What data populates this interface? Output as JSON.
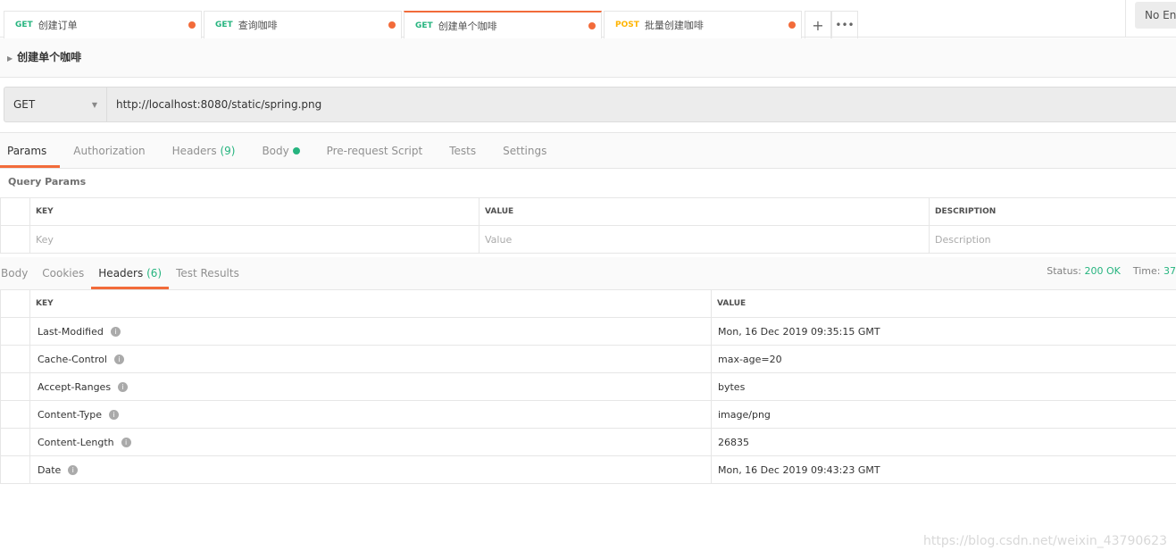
{
  "tabs": [
    {
      "method": "GET",
      "name": "创建订单",
      "method_color": "#26b47f",
      "active": false
    },
    {
      "method": "GET",
      "name": "查询咖啡",
      "method_color": "#26b47f",
      "active": false
    },
    {
      "method": "GET",
      "name": "创建单个咖啡",
      "method_color": "#26b47f",
      "active": true
    },
    {
      "method": "POST",
      "name": "批量创建咖啡",
      "method_color": "#ffb400",
      "active": false
    }
  ],
  "environment": "No En",
  "request_name": "创建单个咖啡",
  "method": "GET",
  "url": "http://localhost:8080/static/spring.png",
  "request_tabs": {
    "params": "Params",
    "authorization": "Authorization",
    "headers": "Headers",
    "headers_count": "(9)",
    "body": "Body",
    "prerequest": "Pre-request Script",
    "tests": "Tests",
    "settings": "Settings"
  },
  "query_params": {
    "title": "Query Params",
    "columns": [
      "KEY",
      "VALUE",
      "DESCRIPTION"
    ],
    "placeholders": [
      "Key",
      "Value",
      "Description"
    ]
  },
  "response_tabs": {
    "body": "Body",
    "cookies": "Cookies",
    "headers": "Headers",
    "headers_count": "(6)",
    "test_results": "Test Results"
  },
  "status": {
    "label": "Status:",
    "value": "200 OK",
    "time_label": "Time:",
    "time_value": "37"
  },
  "response_headers": {
    "columns": [
      "KEY",
      "VALUE"
    ],
    "rows": [
      {
        "key": "Last-Modified",
        "value": "Mon, 16 Dec 2019 09:35:15 GMT"
      },
      {
        "key": "Cache-Control",
        "value": "max-age=20"
      },
      {
        "key": "Accept-Ranges",
        "value": "bytes"
      },
      {
        "key": "Content-Type",
        "value": "image/png"
      },
      {
        "key": "Content-Length",
        "value": "26835"
      },
      {
        "key": "Date",
        "value": "Mon, 16 Dec 2019 09:43:23 GMT"
      }
    ]
  },
  "watermark": "https://blog.csdn.net/weixin_43790623",
  "colors": {
    "accent": "#f26b3a",
    "success": "#26b47f"
  }
}
